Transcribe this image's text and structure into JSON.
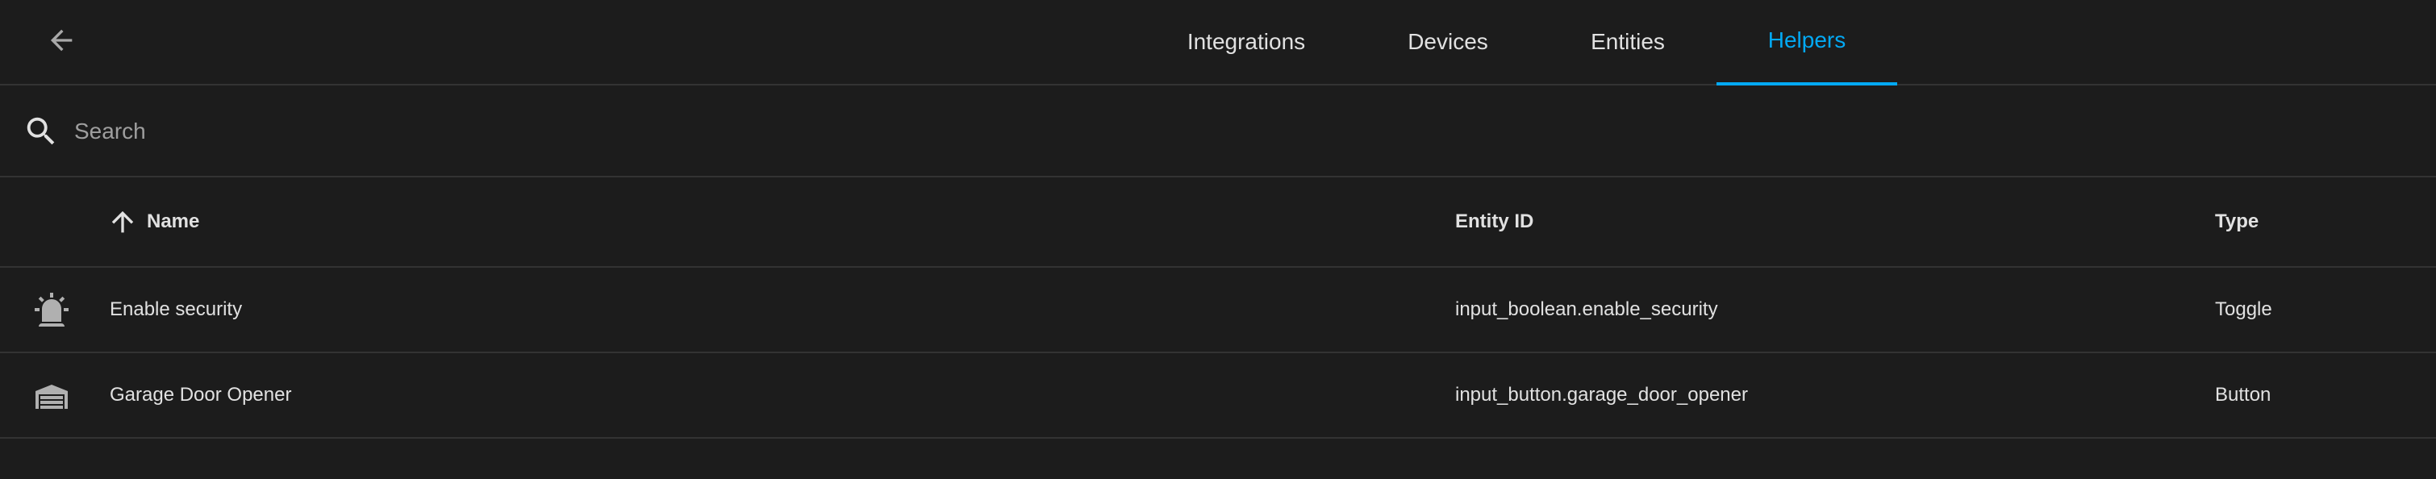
{
  "toolbar": {
    "back_icon": "arrow-left-icon"
  },
  "tabs": [
    {
      "label": "Integrations",
      "active": false
    },
    {
      "label": "Devices",
      "active": false
    },
    {
      "label": "Entities",
      "active": false
    },
    {
      "label": "Helpers",
      "active": true
    }
  ],
  "search": {
    "placeholder": "Search",
    "value": "",
    "icon": "search-icon"
  },
  "table": {
    "columns": {
      "name": "Name",
      "entity_id": "Entity ID",
      "type": "Type"
    },
    "sort": {
      "column": "Name",
      "direction": "ascending",
      "icon": "arrow-up-icon"
    },
    "rows": [
      {
        "icon": "alarm-light-icon",
        "name": "Enable security",
        "entity_id": "input_boolean.enable_security",
        "type": "Toggle"
      },
      {
        "icon": "garage-icon",
        "name": "Garage Door Opener",
        "entity_id": "input_button.garage_door_opener",
        "type": "Button"
      }
    ]
  },
  "colors": {
    "background": "#1c1c1c",
    "divider": "#333333",
    "text": "#e1e1e1",
    "accent": "#03a9f4",
    "placeholder": "#9e9e9e",
    "icon": "#b0b0b0"
  }
}
